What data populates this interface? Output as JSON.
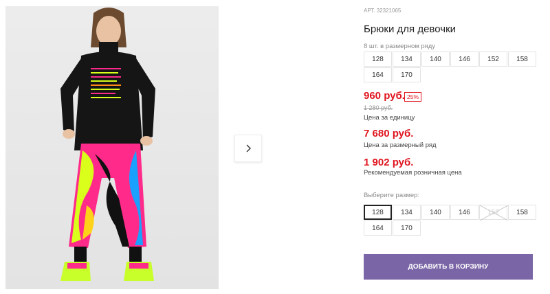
{
  "product": {
    "article": "АРТ. 32321065",
    "title": "Брюки для девочки",
    "image_alt": "Girl wearing black turtleneck and multicolor marble-print pants"
  },
  "pack": {
    "caption": "8 шт. в размерном ряду",
    "sizes": [
      "128",
      "134",
      "140",
      "146",
      "152",
      "158",
      "164",
      "170"
    ]
  },
  "pricing": {
    "unit_price": "960 руб.",
    "discount": "25%",
    "old_price": "1 280 руб.",
    "unit_caption": "Цена за единицу",
    "row_price": "7 680 руб.",
    "row_caption": "Цена за размерный ряд",
    "rrp_price": "1 902 руб.",
    "rrp_caption": "Рекомендуемая розничная цена"
  },
  "size_picker": {
    "label": "Выберите размер:",
    "sizes": [
      {
        "label": "128",
        "state": "selected"
      },
      {
        "label": "134",
        "state": "available"
      },
      {
        "label": "140",
        "state": "available"
      },
      {
        "label": "146",
        "state": "available"
      },
      {
        "label": "152",
        "state": "unavailable"
      },
      {
        "label": "158",
        "state": "available"
      },
      {
        "label": "164",
        "state": "available"
      },
      {
        "label": "170",
        "state": "available"
      }
    ]
  },
  "cart": {
    "add_label": "ДОБАВИТЬ В КОРЗИНУ"
  },
  "colors": {
    "accent": "#7a65a6",
    "price_red": "#e0141e"
  },
  "icons": {
    "next": "chevron-right-icon"
  }
}
